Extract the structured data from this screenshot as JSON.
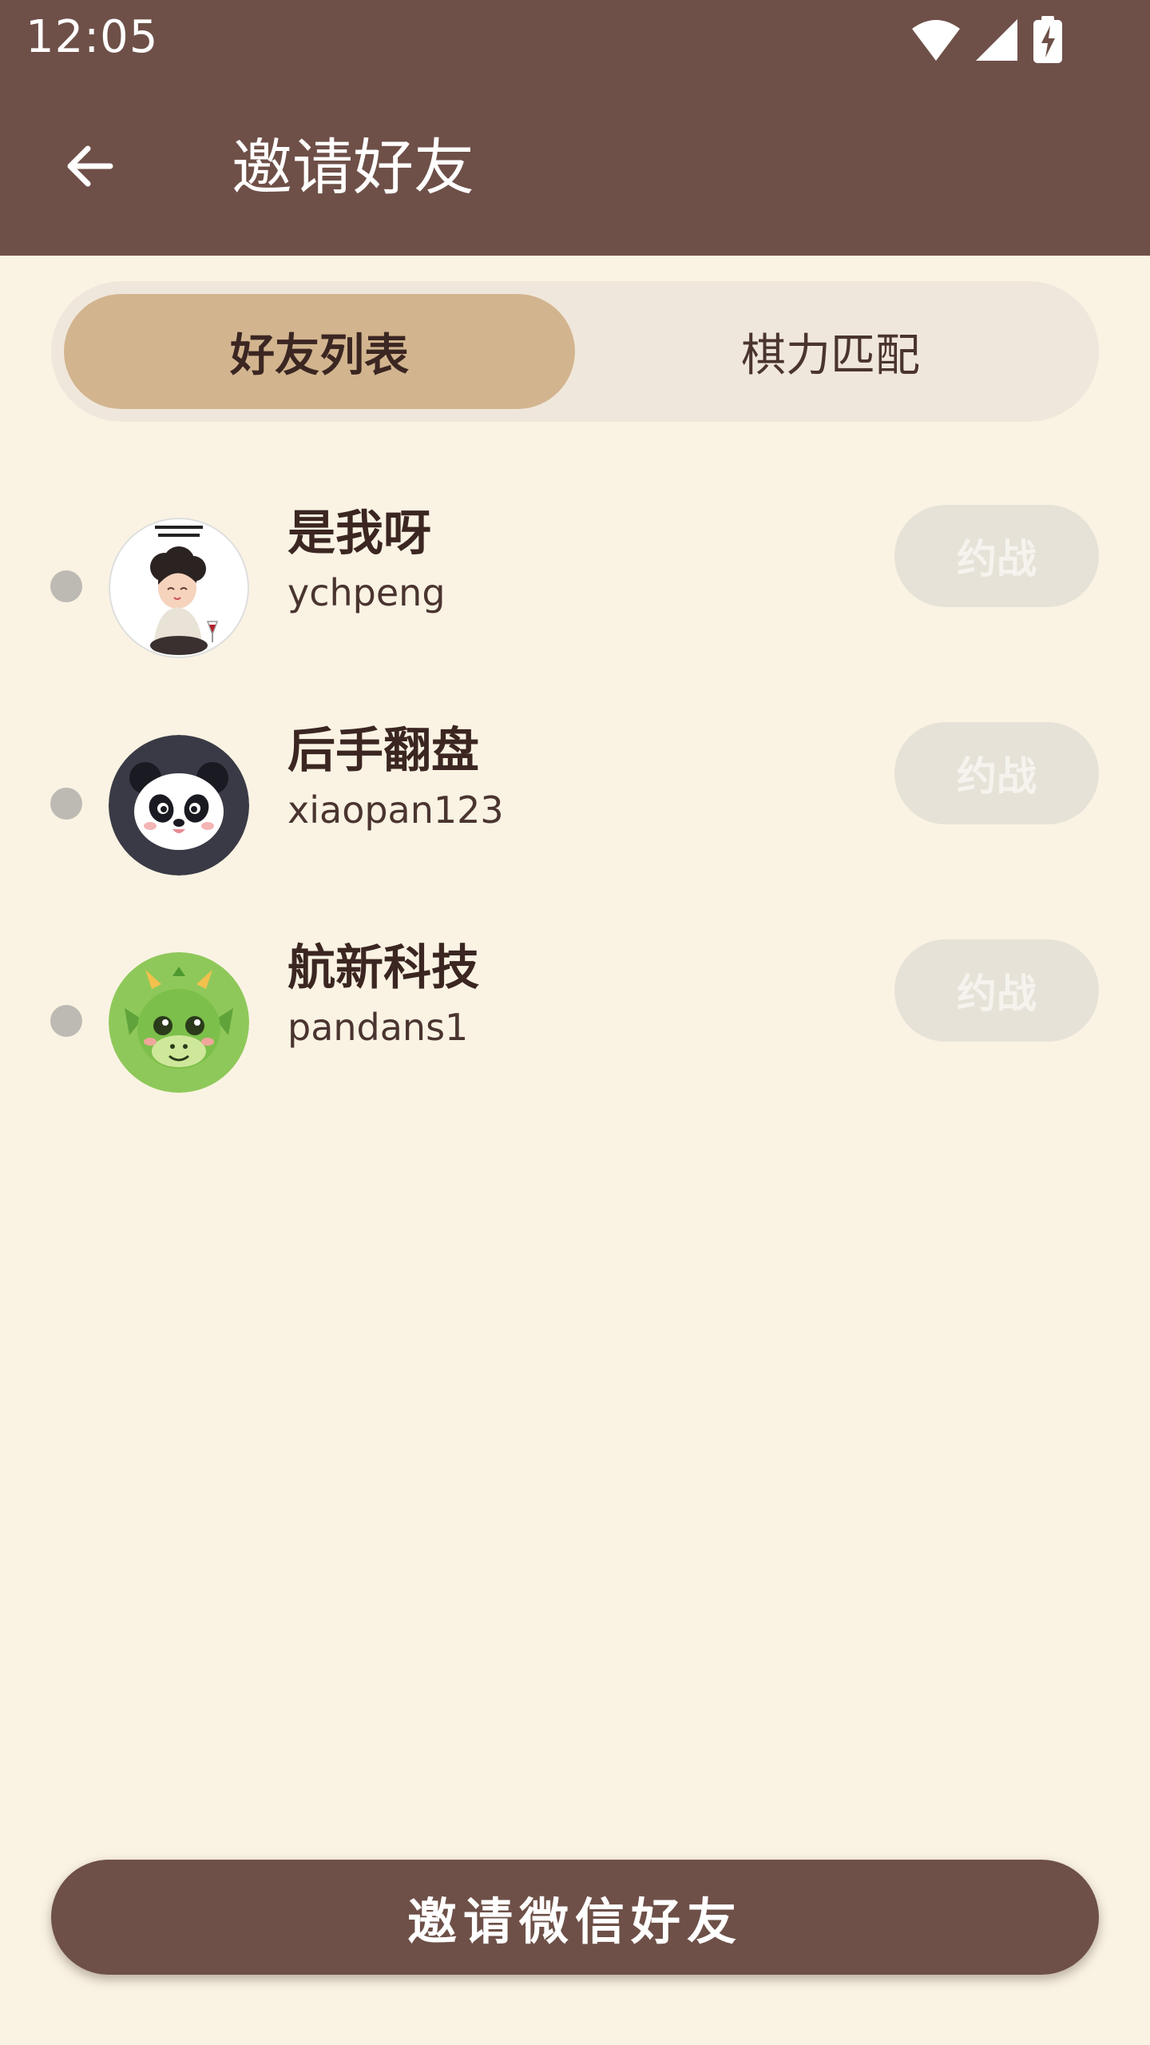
{
  "status_bar": {
    "time": "12:05",
    "icons": [
      "wifi-icon",
      "signal-icon",
      "battery-charging-icon"
    ]
  },
  "app_bar": {
    "back_icon": "arrow-left-icon",
    "title": "邀请好友"
  },
  "tabs": [
    {
      "label": "好友列表",
      "selected": true
    },
    {
      "label": "棋力匹配",
      "selected": false
    }
  ],
  "friends": [
    {
      "name": "是我呀",
      "username": "ychpeng",
      "status": "offline",
      "action_label": "约战",
      "avatar": "girl-illustration-avatar"
    },
    {
      "name": "后手翻盘",
      "username": "xiaopan123",
      "status": "offline",
      "action_label": "约战",
      "avatar": "panda-avatar"
    },
    {
      "name": "航新科技",
      "username": "pandans1",
      "status": "offline",
      "action_label": "约战",
      "avatar": "green-dragon-avatar"
    }
  ],
  "invite_button": {
    "label": "邀请微信好友"
  },
  "colors": {
    "header": "#6e5048",
    "background": "#faf3e3",
    "tab_active": "#d2b58f",
    "tab_track": "#f0e7dc",
    "disabled_button": "#e6e2d8",
    "offline_dot": "#bdbab4"
  }
}
